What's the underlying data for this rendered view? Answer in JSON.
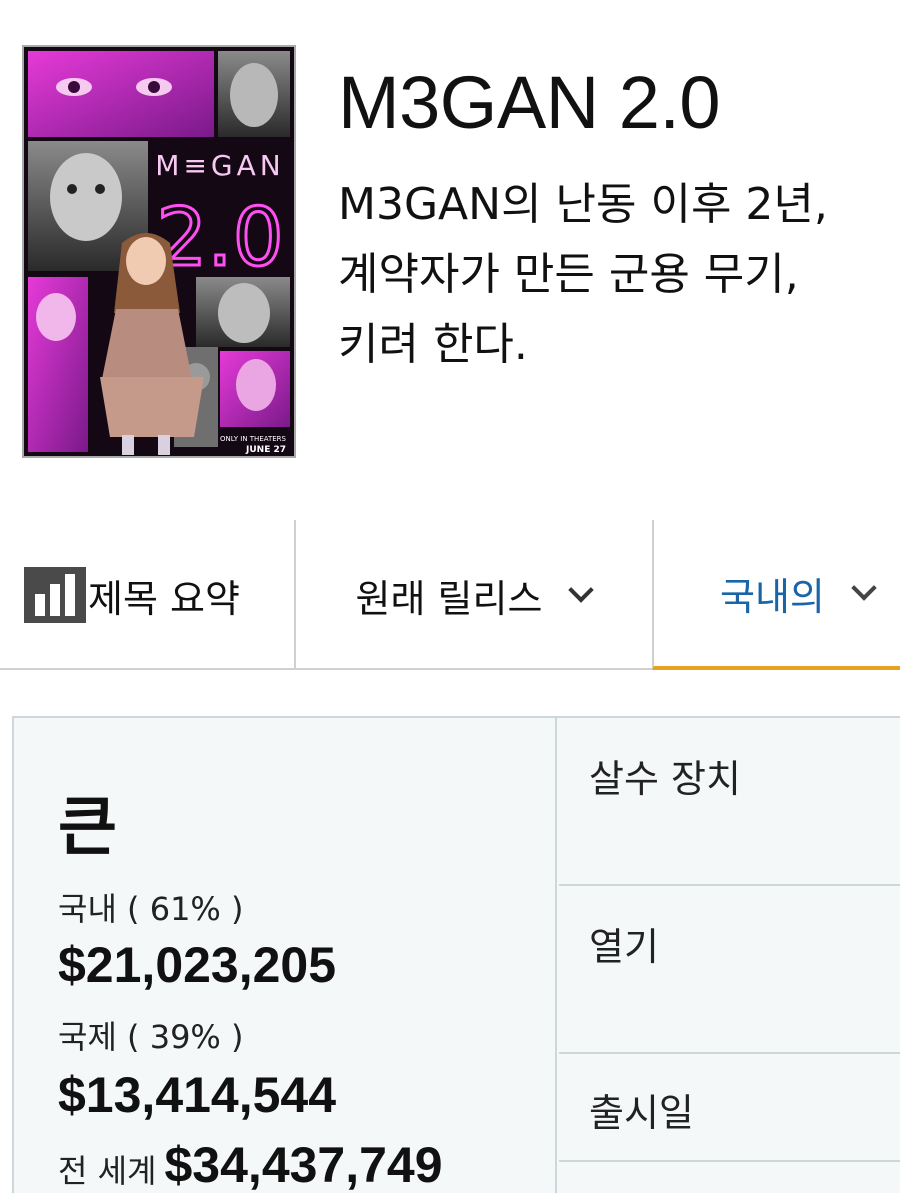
{
  "movie": {
    "title": "M3GAN 2.0",
    "synopsis_lines": [
      "M3GAN의 난동 이후 2년,",
      "계약자가 만든 군용 무기, ",
      "키려 한다."
    ],
    "poster": {
      "logo_text": "M≡GAN",
      "number_text": "2.0",
      "tagline": "ONLY IN THEATERS",
      "date": "JUNE 27"
    }
  },
  "tabs": {
    "summary_label": "제목 요약",
    "release_label": "원래 릴리스",
    "domestic_label": "국내의"
  },
  "box_office": {
    "heading": "큰",
    "domestic_label": "국내 ( 61% )",
    "domestic_amount": "$21,023,205",
    "international_label": "국제 ( 39% )",
    "international_amount": "$13,414,544",
    "worldwide_label": "전 세계",
    "worldwide_amount": "$34,437,749"
  },
  "details": {
    "distributor_label": "살수 장치",
    "opening_label": "열기",
    "release_date_label": "출시일"
  },
  "colors": {
    "accent_tab": "#1a65a8",
    "tab_underline": "#e6a21c",
    "panel_bg": "#f4f8f9",
    "poster_magenta": "#e33ad6"
  }
}
